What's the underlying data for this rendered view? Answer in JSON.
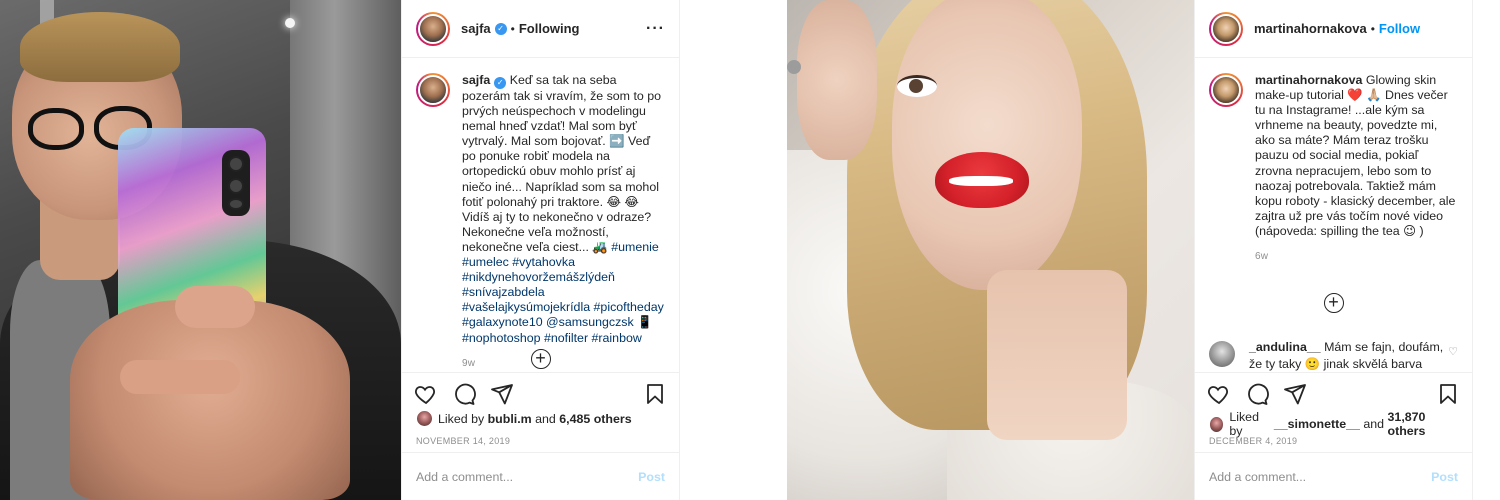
{
  "posts": [
    {
      "username": "sajfa",
      "verified": true,
      "relationship": "Following",
      "more_icon": "more-horizontal-icon",
      "caption": "Keď sa tak na seba pozerám tak si vravím, že som to po prvých neúspechoch v modelingu nemal hneď vzdať! Mal som byť vytrvalý. Mal som bojovať. ➡️ Veď po ponuke robiť modela na ortopedickú obuv mohlo prísť aj niečo iné... Napríklad som sa mohol fotiť polonahý pri traktore. 😂 😂 Vidíš aj ty to nekonečno v odraze? Nekonečne veľa možností, nekonečne veľa ciest... 🚜",
      "hashtags": "#umenie #umelec #vytahovka #nikdynehovoržemášzlýdeň #snívajzabdela #vašelajkysúmojekrídla #picoftheday #galaxynote10 @samsungczsk 📱 #nophotoshop #nofilter #rainbow",
      "age": "9w",
      "liked_by_user": "bubli.m",
      "liked_by_rest": "6,485 others",
      "liked_by_prefix": "Liked by",
      "liked_and": "and",
      "date": "NOVEMBER 14, 2019",
      "comment_placeholder": "Add a comment...",
      "post_label": "Post"
    },
    {
      "username": "martinahornakova",
      "verified": false,
      "relationship": "Follow",
      "more_icon": "more-horizontal-icon",
      "caption": "Glowing skin make-up tutorial ❤️ 🙏🏼 Dnes večer tu na Instagrame! ...ale kým sa vrhneme na beauty, povedzte mi, ako sa máte? Mám teraz trošku pauzu od social media, pokiaľ zrovna nepracujem, lebo som to naozaj potrebovala. Taktiež mám kopu roboty - klasický december, ale zajtra už pre vás točím nové video (nápoveda: spilling the tea 😉 )",
      "age": "6w",
      "reply_user": "_andulina__",
      "reply_text": "Mám se fajn, doufám, že ty taky 🙂 jinak skvělá barva rtěnky",
      "liked_by_user": "__simonette__",
      "liked_by_rest": "31,870 others",
      "liked_by_prefix": "Liked by",
      "liked_and": "and",
      "date": "DECEMBER 4, 2019",
      "comment_placeholder": "Add a comment...",
      "post_label": "Post"
    }
  ],
  "colors": {
    "link": "#00376b",
    "follow_blue": "#0095f6",
    "verified_blue": "#3897f0",
    "muted": "#8e8e8e",
    "post_disabled": "#b2dffc",
    "lipstick": "#d4212a"
  },
  "icons": [
    "heart-icon",
    "comment-icon",
    "share-icon",
    "bookmark-icon",
    "plus-circle-icon",
    "verified-icon",
    "more-horizontal-icon"
  ]
}
